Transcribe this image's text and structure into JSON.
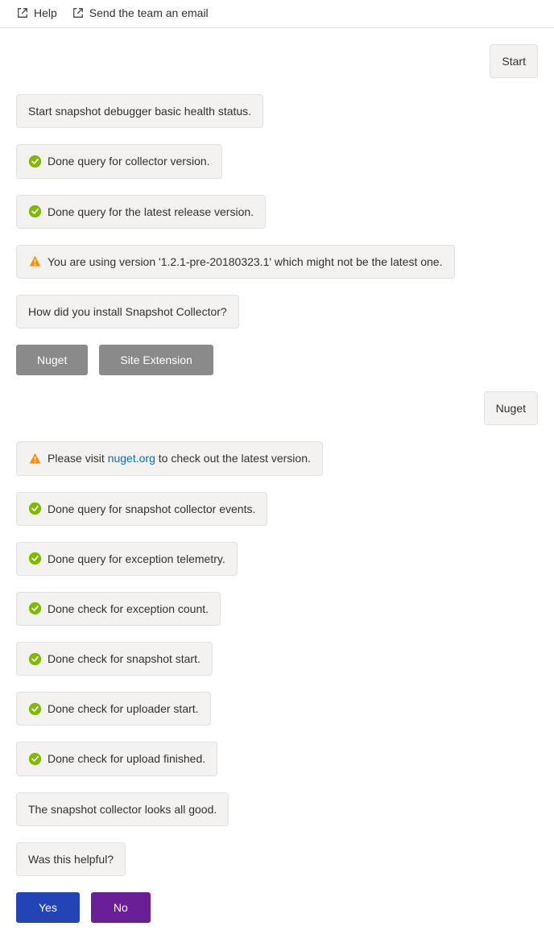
{
  "toolbar": {
    "help_label": "Help",
    "email_label": "Send the team an email"
  },
  "chat": {
    "user_start": "Start",
    "msg_start_health": "Start snapshot debugger basic health status.",
    "msg_collector_version": "Done query for collector version.",
    "msg_latest_release": "Done query for the latest release version.",
    "msg_warn_version": "You are using version '1.2.1-pre-20180323.1' which might not be the latest one.",
    "msg_how_install": "How did you install Snapshot Collector?",
    "btn_nuget": "Nuget",
    "btn_site_ext": "Site Extension",
    "user_nuget": "Nuget",
    "msg_visit_prefix": "Please visit ",
    "msg_visit_link": "nuget.org",
    "msg_visit_suffix": " to check out the latest version.",
    "msg_collector_events": "Done query for snapshot collector events.",
    "msg_exception_telemetry": "Done query for exception telemetry.",
    "msg_exception_count": "Done check for exception count.",
    "msg_snapshot_start": "Done check for snapshot start.",
    "msg_uploader_start": "Done check for uploader start.",
    "msg_upload_finished": "Done check for upload finished.",
    "msg_all_good": "The snapshot collector looks all good.",
    "msg_helpful": "Was this helpful?",
    "btn_yes": "Yes",
    "btn_no": "No"
  }
}
